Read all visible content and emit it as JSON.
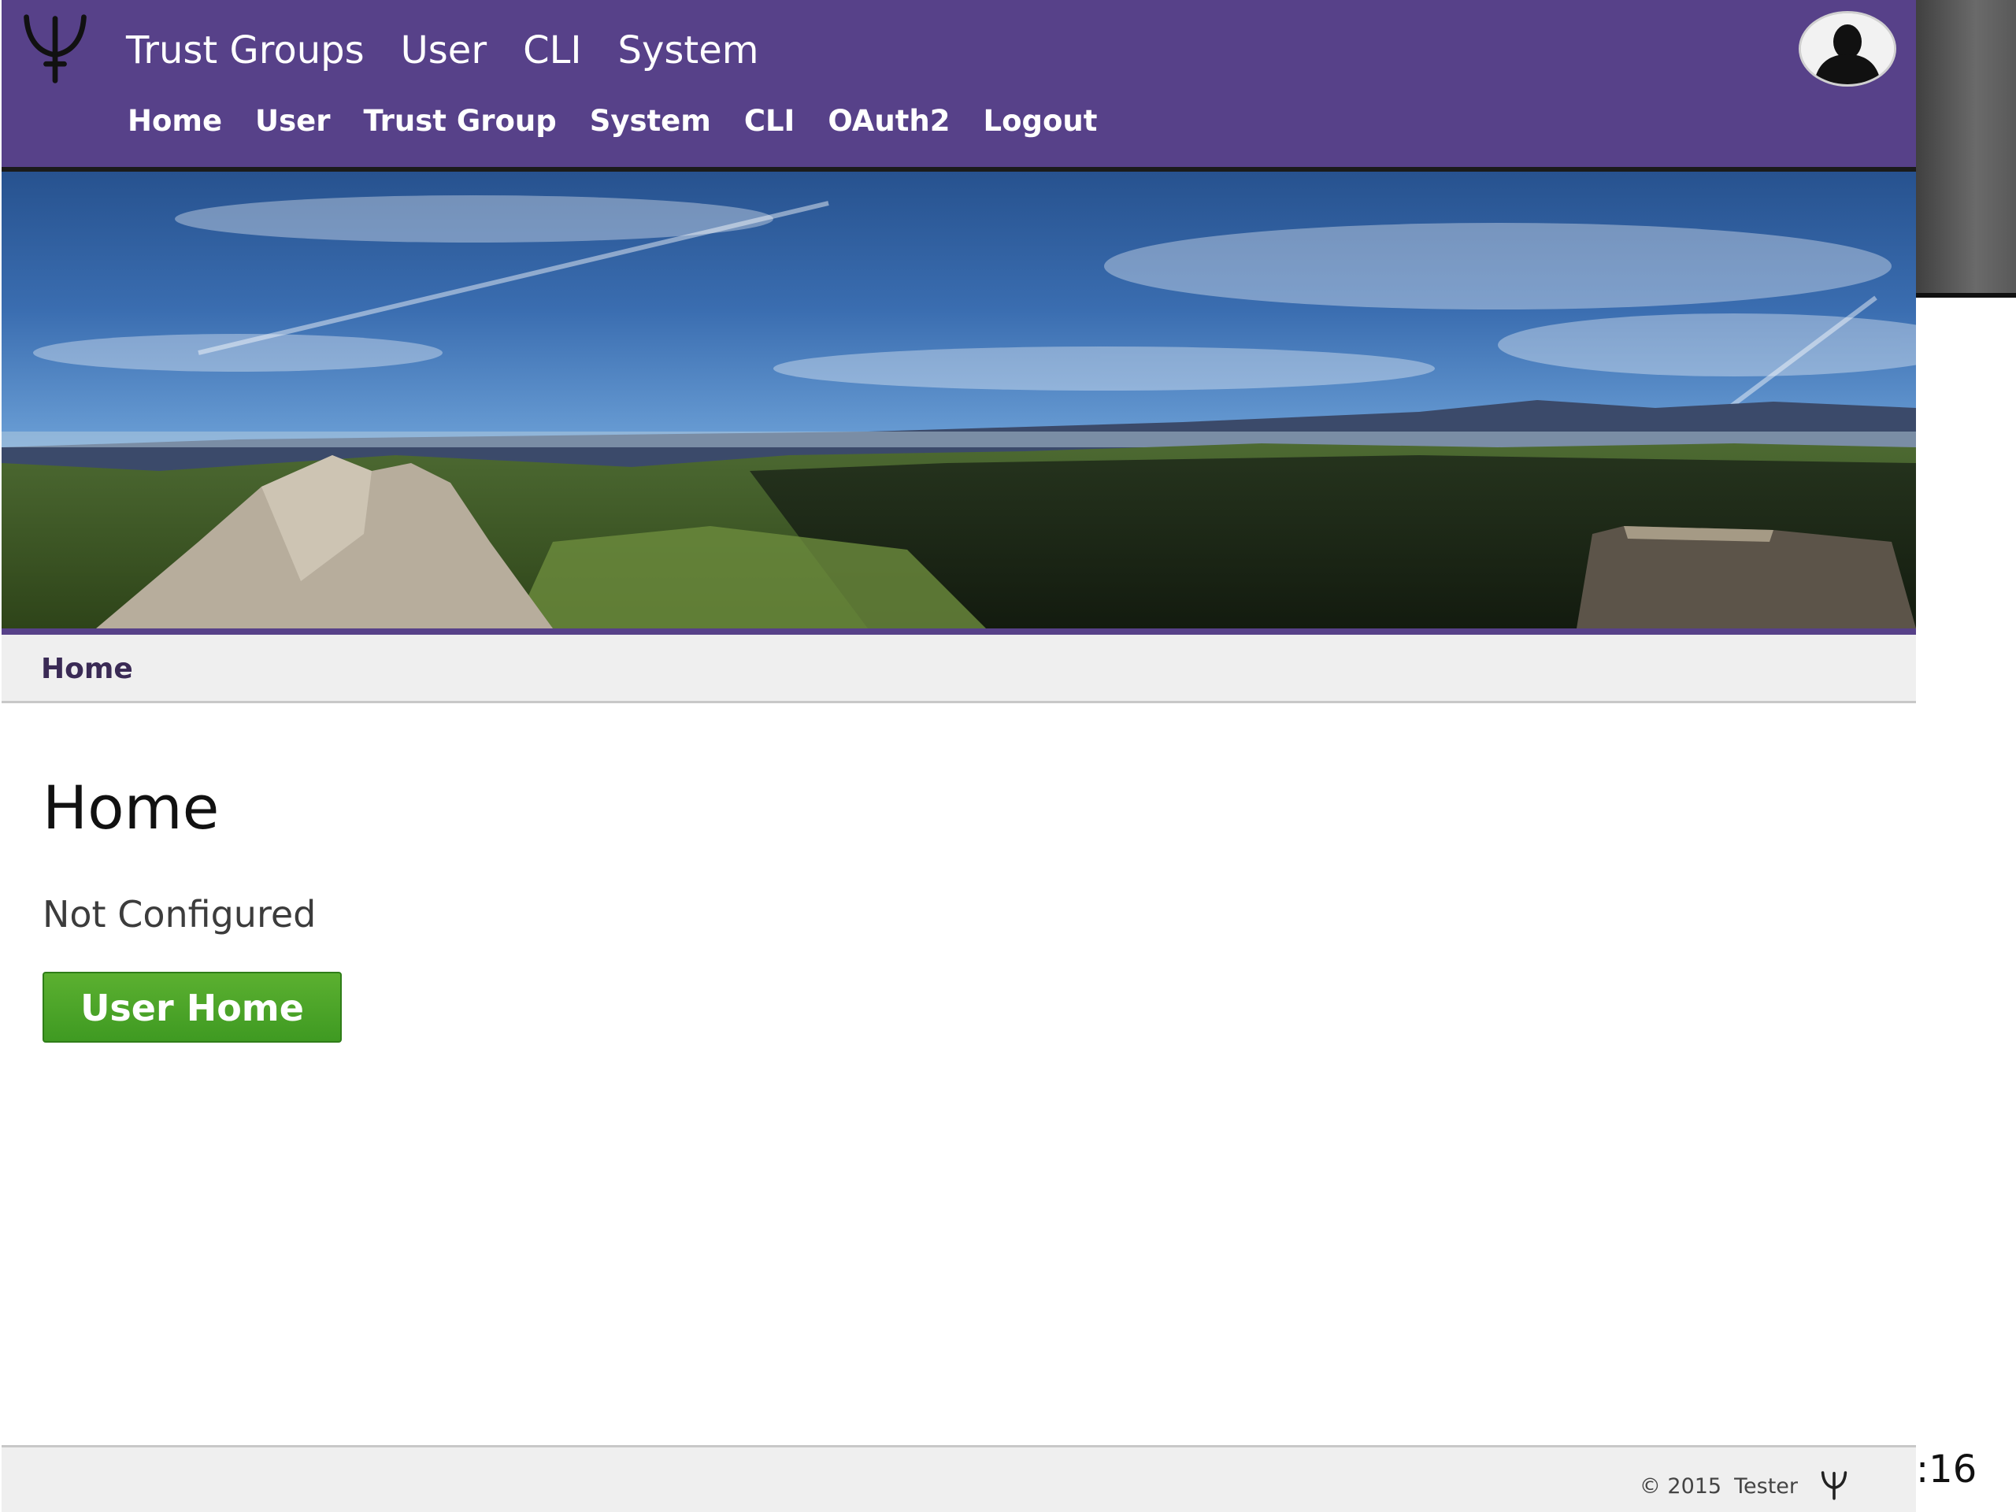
{
  "header": {
    "top_nav": [
      {
        "label": "Trust Groups"
      },
      {
        "label": "User"
      },
      {
        "label": "CLI"
      },
      {
        "label": "System"
      }
    ],
    "sub_nav": [
      {
        "label": "Home"
      },
      {
        "label": "User"
      },
      {
        "label": "Trust Group"
      },
      {
        "label": "System"
      },
      {
        "label": "CLI"
      },
      {
        "label": "OAuth2"
      },
      {
        "label": "Logout"
      }
    ],
    "logo_icon": "trident-icon",
    "avatar_icon": "user-silhouette-icon"
  },
  "breadcrumb": {
    "items": [
      "Home"
    ]
  },
  "main": {
    "title": "Home",
    "status": "Not Configured",
    "user_home_button": "User Home"
  },
  "footer": {
    "copyright": "© 2015",
    "author": "Tester",
    "logo_icon": "trident-icon"
  },
  "overlay": {
    "corner_text": ":16"
  },
  "colors": {
    "header_bg": "#574189",
    "button_green": "#4aa326",
    "breadcrumb_bg": "#efefef"
  }
}
